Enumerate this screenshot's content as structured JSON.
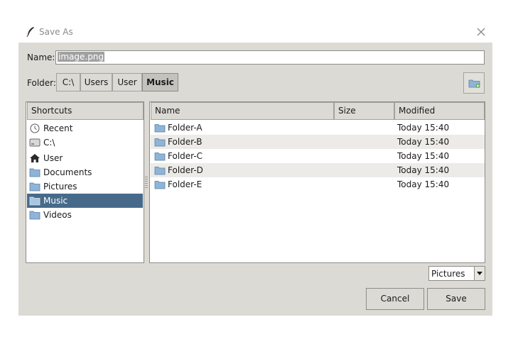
{
  "window": {
    "title": "Save As"
  },
  "name_field": {
    "label": "Name:",
    "value": "image.png"
  },
  "folder": {
    "label": "Folder:",
    "crumbs": [
      {
        "label": "C:\\"
      },
      {
        "label": "Users"
      },
      {
        "label": "User"
      },
      {
        "label": "Music",
        "active": true
      }
    ]
  },
  "shortcuts": {
    "header": "Shortcuts",
    "items": [
      {
        "label": "Recent",
        "icon": "recent-icon"
      },
      {
        "label": "C:\\",
        "icon": "drive-icon"
      },
      {
        "label": "User",
        "icon": "home-icon"
      },
      {
        "label": "Documents",
        "icon": "folder-icon"
      },
      {
        "label": "Pictures",
        "icon": "folder-icon"
      },
      {
        "label": "Music",
        "icon": "folder-icon",
        "selected": true
      },
      {
        "label": "Videos",
        "icon": "folder-icon"
      }
    ]
  },
  "files": {
    "columns": {
      "name": "Name",
      "size": "Size",
      "modified": "Modified"
    },
    "rows": [
      {
        "name": "Folder-A",
        "modified": "Today 15:40"
      },
      {
        "name": "Folder-B",
        "modified": "Today 15:40"
      },
      {
        "name": "Folder-C",
        "modified": "Today 15:40"
      },
      {
        "name": "Folder-D",
        "modified": "Today 15:40"
      },
      {
        "name": "Folder-E",
        "modified": "Today 15:40"
      }
    ]
  },
  "filter": {
    "selected": "Pictures"
  },
  "buttons": {
    "cancel": "Cancel",
    "save": "Save"
  },
  "colors": {
    "selection": "#476a8a",
    "dialog_bg": "#dcdad5",
    "alt_row": "#ecebe7"
  }
}
